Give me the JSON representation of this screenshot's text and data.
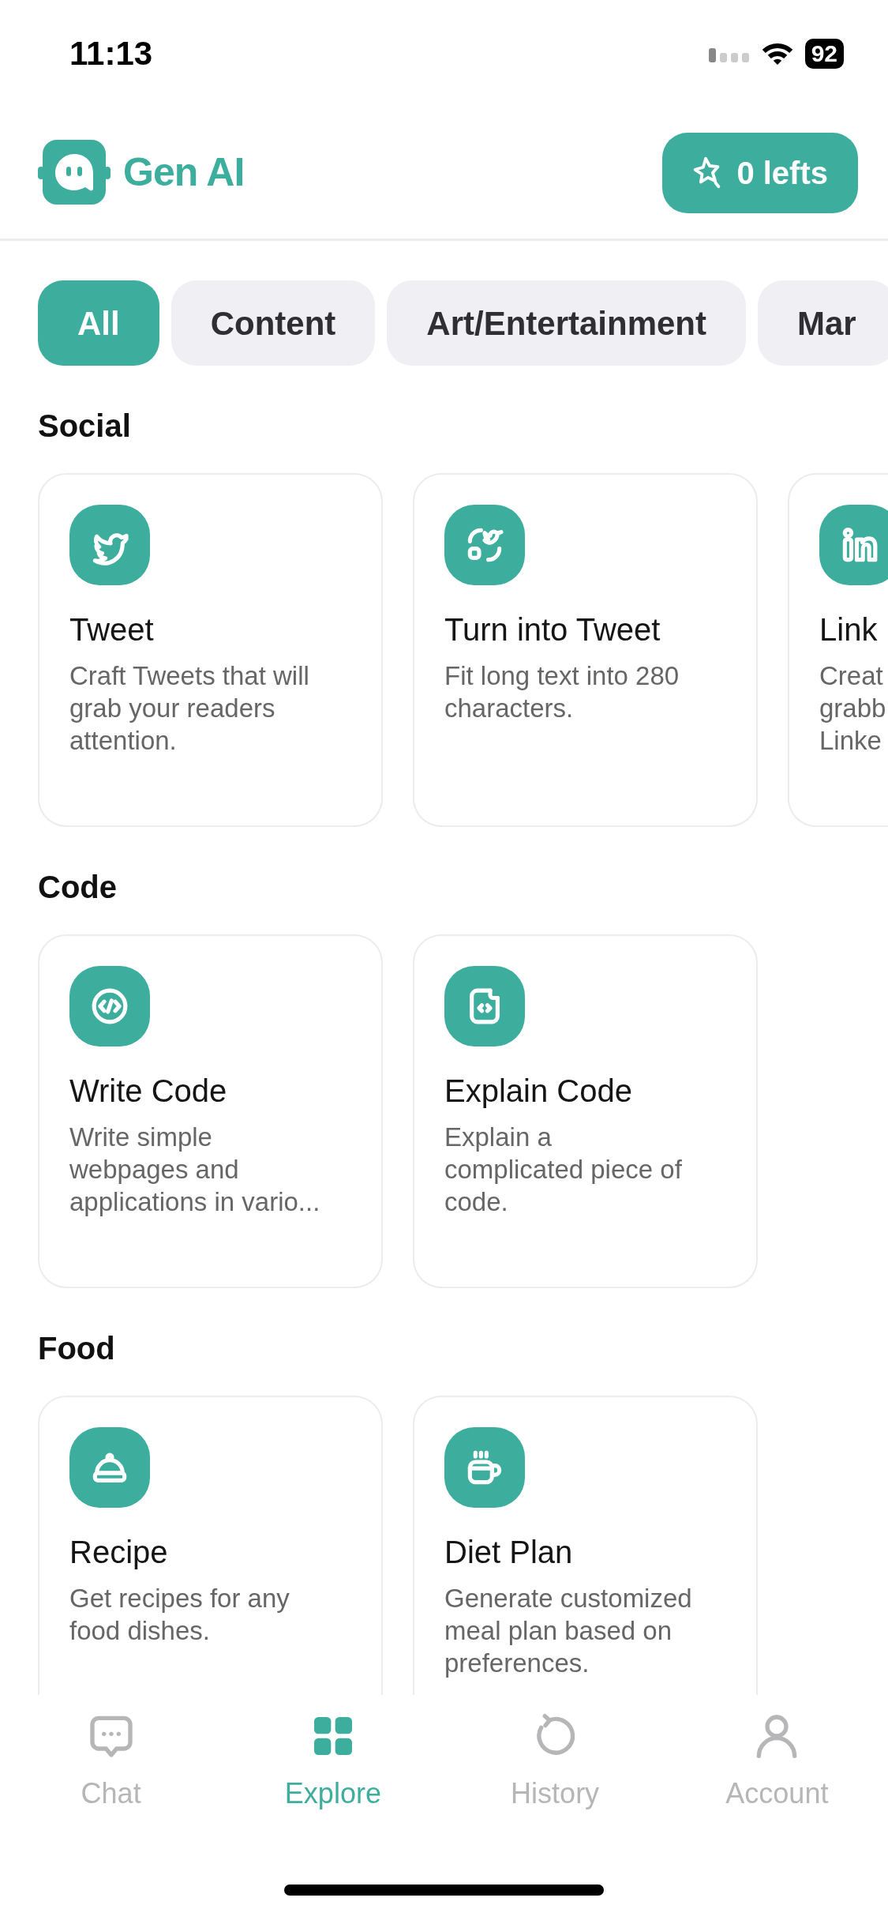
{
  "status_bar": {
    "time": "11:13",
    "battery": "92"
  },
  "header": {
    "app_name": "Gen AI",
    "credits_button": "0 lefts"
  },
  "categories": [
    {
      "label": "All",
      "selected": true
    },
    {
      "label": "Content",
      "selected": false
    },
    {
      "label": "Art/Entertainment",
      "selected": false
    },
    {
      "label": "Mar",
      "selected": false
    }
  ],
  "sections": [
    {
      "title": "Social",
      "cards": [
        {
          "kind": "bird",
          "title": "Tweet",
          "lines": [
            "Craft Tweets that will",
            "grab your readers",
            "attention."
          ]
        },
        {
          "kind": "bird-convert",
          "title": "Turn into Tweet",
          "lines": [
            "Fit long text into 280",
            "characters."
          ]
        },
        {
          "kind": "linkedin",
          "title": "Link",
          "lines": [
            "Creat",
            "grabb",
            "Linke"
          ]
        }
      ]
    },
    {
      "title": "Code",
      "cards": [
        {
          "kind": "code",
          "title": "Write Code",
          "lines": [
            "Write simple",
            "webpages and",
            "applications in vario..."
          ]
        },
        {
          "kind": "code-file",
          "title": "Explain Code",
          "lines": [
            "Explain a",
            "complicated piece of",
            "code."
          ]
        }
      ]
    },
    {
      "title": "Food",
      "cards": [
        {
          "kind": "cloche",
          "title": "Recipe",
          "lines": [
            "Get recipes for any",
            "food dishes."
          ]
        },
        {
          "kind": "mug",
          "title": "Diet Plan",
          "lines": [
            "Generate customized",
            "meal plan based on",
            "preferences."
          ]
        }
      ]
    }
  ],
  "bottom_nav": [
    {
      "kind": "chat",
      "label": "Chat",
      "selected": false
    },
    {
      "kind": "grid",
      "label": "Explore",
      "selected": true
    },
    {
      "kind": "history",
      "label": "History",
      "selected": false
    },
    {
      "kind": "person",
      "label": "Account",
      "selected": false
    }
  ]
}
